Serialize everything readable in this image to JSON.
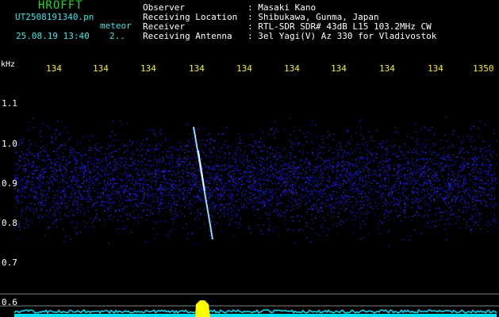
{
  "brand": "HROFFT",
  "file": {
    "name": "UT2508191340.pn",
    "tag": "meteor",
    "datetime": "25.08.19 13:40",
    "mode": "2.."
  },
  "info": {
    "labels": [
      "Observer",
      "Receiving Location",
      "Receiver",
      "Receiving Antenna"
    ],
    "values": [
      ": Masaki Kano",
      ": Shibukawa, Gunma, Japan",
      ": RTL-SDR SDR# 43dB L15 103.2MHz CW",
      ": 3el Yagi(V) Az 330 for Vladivostok"
    ]
  },
  "axis": {
    "unit": "kHz",
    "time_ticks": [
      "134",
      "134",
      "134",
      "134",
      "134",
      "134",
      "134",
      "134",
      "134",
      "1350"
    ],
    "freq_ticks": [
      "1.1",
      "1.0",
      "0.9",
      "0.8",
      "0.7",
      "0.6"
    ]
  },
  "colors": {
    "noise": "#2a2aff",
    "trail": "#8fdcff",
    "signal": "#ffff00",
    "baseline": "#00e5ff",
    "text_green": "#27d62b",
    "text_cyan": "#3fe6e6"
  }
}
